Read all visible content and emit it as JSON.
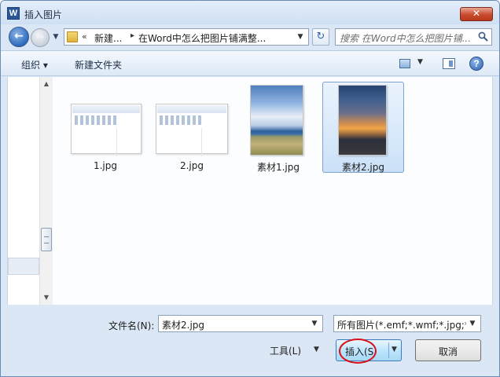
{
  "window": {
    "title": "插入图片",
    "app_icon_letter": "W",
    "close_label": "✕"
  },
  "navbar": {
    "back_glyph": "←",
    "forward_glyph": "→",
    "history_glyph": "▼",
    "breadcrumb_chevron": "«",
    "breadcrumb": [
      "新建...",
      "在Word中怎么把图片铺满整..."
    ],
    "breadcrumb_separator": "▸",
    "dropdown_glyph": "▼",
    "refresh_glyph": "↻",
    "search_placeholder": "搜索 在Word中怎么把图片铺..."
  },
  "toolbar": {
    "organize_label": "组织 ▾",
    "new_folder_label": "新建文件夹",
    "view_dropdown_glyph": "▼",
    "help_label": "?"
  },
  "scrollbar": {
    "up_glyph": "▲",
    "down_glyph": "▼"
  },
  "files": [
    {
      "name": "1.jpg",
      "kind": "document",
      "selected": false
    },
    {
      "name": "2.jpg",
      "kind": "document",
      "selected": false
    },
    {
      "name": "素材1.jpg",
      "kind": "photo-sky-grass",
      "selected": false
    },
    {
      "name": "素材2.jpg",
      "kind": "photo-sunset",
      "selected": true
    }
  ],
  "bottom": {
    "filename_label": "文件名(N):",
    "filename_value": "素材2.jpg",
    "filetype_value": "所有图片(*.emf;*.wmf;*.jpg;*.jpeg;*.jfif;*.png;*.bmp;*.gif)",
    "tools_label": "工具(L)",
    "insert_label": "插入(S",
    "cancel_label": "取消",
    "dropdown_glyph": "▼"
  },
  "colors": {
    "window_bg": "#dbe7f5",
    "selection_border": "#7da2ce",
    "highlight_circle": "#d8111b"
  }
}
